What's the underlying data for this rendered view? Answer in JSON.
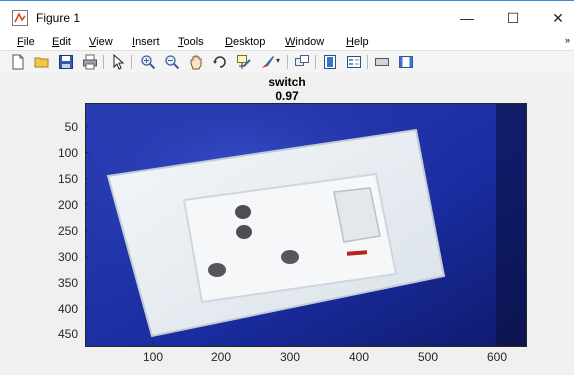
{
  "window": {
    "title": "Figure 1",
    "minimize_glyph": "—",
    "maximize_glyph": "☐",
    "close_glyph": "✕"
  },
  "menu": {
    "items": [
      {
        "label": "File",
        "mnemonic": "F",
        "rest": "ile"
      },
      {
        "label": "Edit",
        "mnemonic": "E",
        "rest": "dit"
      },
      {
        "label": "View",
        "mnemonic": "V",
        "rest": "iew"
      },
      {
        "label": "Insert",
        "mnemonic": "I",
        "rest": "nsert"
      },
      {
        "label": "Tools",
        "mnemonic": "T",
        "rest": "ools"
      },
      {
        "label": "Desktop",
        "mnemonic": "D",
        "rest": "esktop"
      },
      {
        "label": "Window",
        "mnemonic": "W",
        "rest": "indow"
      },
      {
        "label": "Help",
        "mnemonic": "H",
        "rest": "elp"
      }
    ],
    "overflow_glyph": "»"
  },
  "toolbar": {
    "icons": [
      "new-figure-icon",
      "open-file-icon",
      "save-icon",
      "print-icon",
      "pointer-icon",
      "zoom-in-icon",
      "zoom-out-icon",
      "pan-icon",
      "rotate-3d-icon",
      "data-cursor-icon",
      "brush-icon",
      "link-plot-icon",
      "colorbar-icon",
      "legend-icon",
      "hide-plot-tools-icon",
      "show-plot-tools-icon"
    ]
  },
  "axes": {
    "title_line1": "switch",
    "title_line2": "0.97",
    "yticks": [
      "50",
      "100",
      "150",
      "200",
      "250",
      "300",
      "350",
      "400",
      "450"
    ],
    "xticks": [
      "100",
      "200",
      "300",
      "400",
      "500",
      "600"
    ]
  },
  "image": {
    "subject": "wall-mounted electrical socket with switch",
    "colors": {
      "background": "#1f2fa6",
      "plate": "#e8eef3",
      "switch_indicator": "#b4251a"
    }
  }
}
